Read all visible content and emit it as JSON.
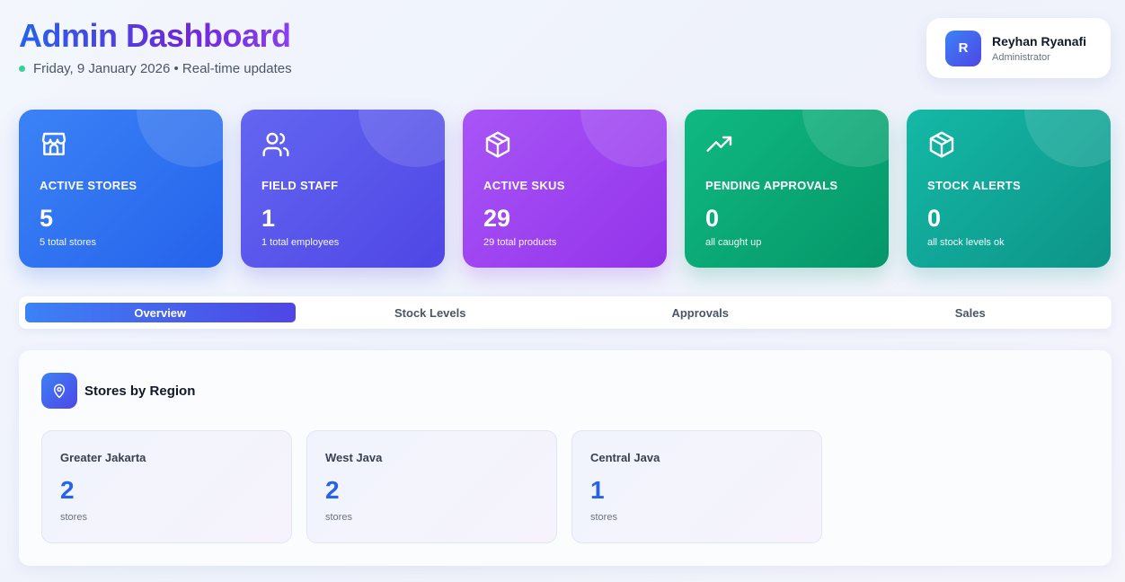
{
  "header": {
    "title": "Admin Dashboard",
    "subtitle": "Friday, 9 January 2026 • Real-time updates"
  },
  "user": {
    "initial": "R",
    "name": "Reyhan Ryanafi",
    "role": "Administrator"
  },
  "stats": [
    {
      "icon": "store-icon",
      "label": "ACTIVE STORES",
      "value": "5",
      "note": "5 total stores",
      "color": "#2563eb"
    },
    {
      "icon": "users-icon",
      "label": "FIELD STAFF",
      "value": "1",
      "note": "1 total employees",
      "color": "#4f46e5"
    },
    {
      "icon": "package-icon",
      "label": "ACTIVE SKUS",
      "value": "29",
      "note": "29 total products",
      "color": "#9333ea"
    },
    {
      "icon": "trending-up-icon",
      "label": "PENDING APPROVALS",
      "value": "0",
      "note": "all caught up",
      "color": "#059669"
    },
    {
      "icon": "package-icon",
      "label": "STOCK ALERTS",
      "value": "0",
      "note": "all stock levels ok",
      "color": "#0d9488"
    }
  ],
  "tabs": [
    {
      "label": "Overview",
      "active": true
    },
    {
      "label": "Stock Levels",
      "active": false
    },
    {
      "label": "Approvals",
      "active": false
    },
    {
      "label": "Sales",
      "active": false
    }
  ],
  "panel": {
    "icon": "map-pin-icon",
    "title": "Stores by Region",
    "regions": [
      {
        "name": "Greater Jakarta",
        "count": "2",
        "unit": "stores"
      },
      {
        "name": "West Java",
        "count": "2",
        "unit": "stores"
      },
      {
        "name": "Central Java",
        "count": "1",
        "unit": "stores"
      }
    ]
  },
  "colors": {
    "accent": "#2563eb",
    "accent_secondary": "#4f46e5",
    "live_dot": "#34d399"
  }
}
